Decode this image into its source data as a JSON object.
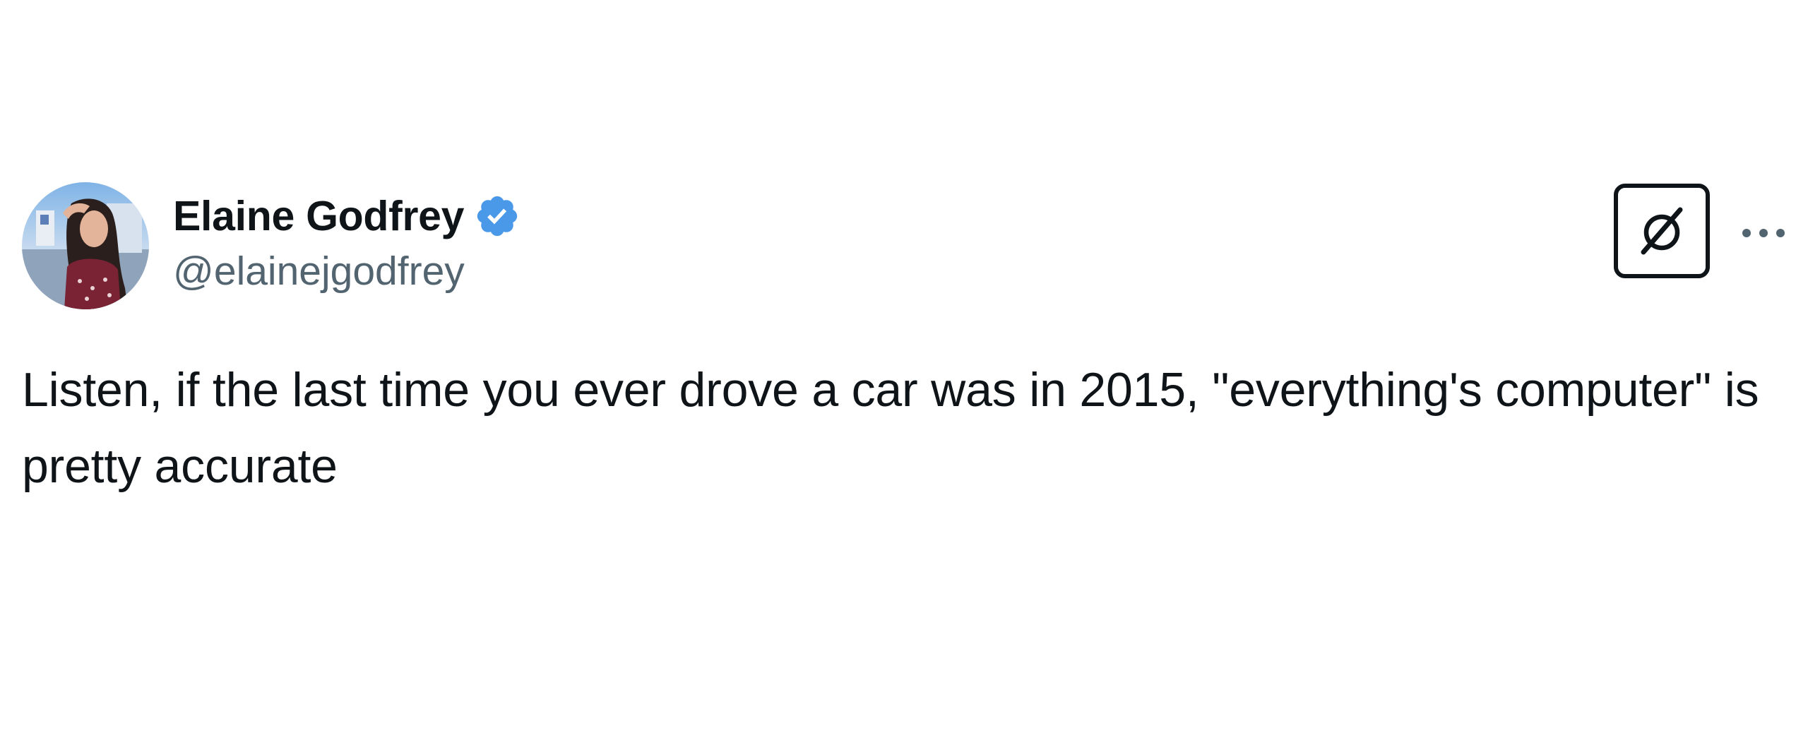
{
  "tweet": {
    "author": {
      "display_name": "Elaine Godfrey",
      "handle": "@elainejgodfrey",
      "verified": true,
      "verified_color": "#4a99e9"
    },
    "text": "Listen, if the last time you ever drove a car was in 2015, \"everything's computer\" is pretty accurate",
    "actions": {
      "grok_icon": "grok-icon",
      "more_icon": "more-icon"
    }
  }
}
